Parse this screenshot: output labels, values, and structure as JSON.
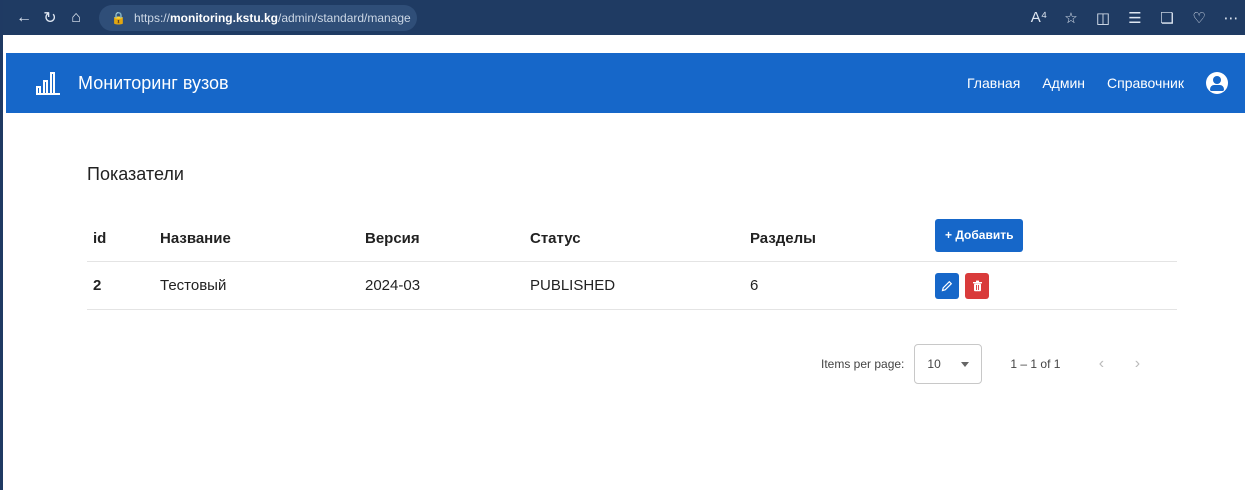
{
  "browser": {
    "url_scheme": "https://",
    "url_host": "monitoring.kstu.kg",
    "url_path": "/admin/standard/manage",
    "read_aloud_label": "A⁴"
  },
  "header": {
    "brand": "Мониторинг вузов",
    "nav": [
      "Главная",
      "Админ",
      "Справочник"
    ]
  },
  "main": {
    "title": "Показатели",
    "add_button": "+ Добавить",
    "columns": [
      "id",
      "Название",
      "Версия",
      "Статус",
      "Разделы"
    ],
    "rows": [
      {
        "id": "2",
        "name": "Тестовый",
        "version": "2024-03",
        "status": "PUBLISHED",
        "sections": "6"
      }
    ]
  },
  "paginator": {
    "items_per_page_label": "Items per page:",
    "page_size": "10",
    "range": "1 – 1 of 1"
  },
  "colors": {
    "primary": "#1667c9",
    "danger": "#d93b3b",
    "browser_bar": "#1f3b63"
  }
}
